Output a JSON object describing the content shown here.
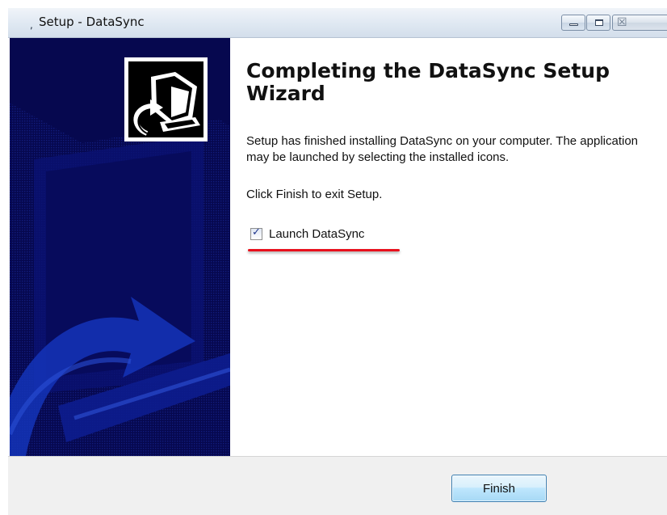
{
  "window": {
    "title": "Setup - DataSync",
    "app_glyph": ",",
    "controls": {
      "minimize_icon": "minimize-icon",
      "maximize_icon": "maximize-icon",
      "close_icon": "close-icon",
      "close_glyph": "☒"
    }
  },
  "banner": {
    "image": "setup-wizard-banner",
    "icon": "computer-install-icon",
    "background_color": "#06084f"
  },
  "content": {
    "heading": "Completing the DataSync Setup Wizard",
    "message": "Setup has finished installing DataSync on your computer. The application may be launched by selecting the installed icons.",
    "instruction": "Click Finish to exit Setup.",
    "launch_option": {
      "label": "Launch DataSync",
      "checked": true,
      "check_glyph": "✓"
    },
    "highlight_color": "#e8101c"
  },
  "footer": {
    "finish_label": "Finish"
  }
}
